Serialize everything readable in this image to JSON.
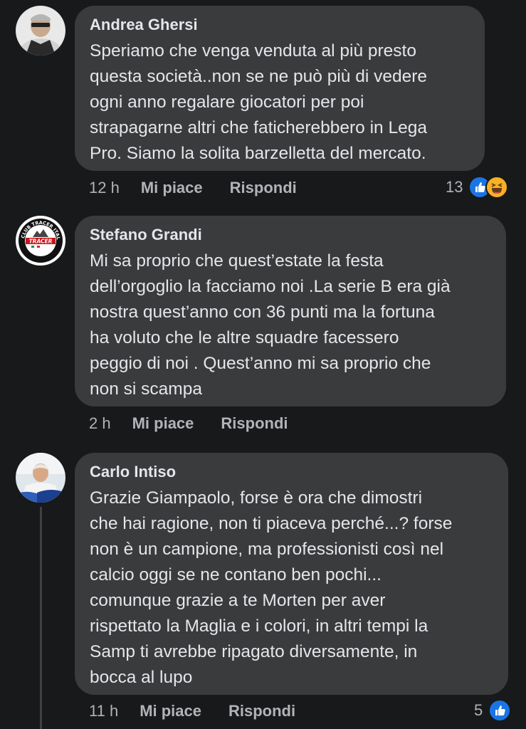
{
  "comments": [
    {
      "author": "Andrea Ghersi",
      "text": "Speriamo che venga venduta al più presto\nquesta società..non se ne può più di vedere\nogni anno regalare giocatori per poi\nstrapagarne altri che faticherebbero in Lega\nPro. Siamo la solita barzelletta del mercato.",
      "time": "12 h",
      "like_label": "Mi piace",
      "reply_label": "Rispondi",
      "reaction_count": "13",
      "reactions": [
        "like-icon",
        "haha-icon"
      ]
    },
    {
      "author": "Stefano Grandi",
      "text": "Mi sa proprio che quest’estate la festa\ndell’orgoglio la facciamo noi .La serie B era già\nnostra quest’anno con 36 punti ma la fortuna\nha voluto che le altre squadre facessero\npeggio di noi . Quest’anno mi sa proprio che\nnon si scampa",
      "time": "2 h",
      "like_label": "Mi piace",
      "reply_label": "Rispondi",
      "avatar_text": "CLUB TRACER ITALIA",
      "avatar_logo": "TRACER"
    },
    {
      "author": "Carlo Intiso",
      "text": "Grazie Giampaolo, forse è ora che dimostri\nche hai ragione, non ti piaceva perché...? forse\nnon è un campione, ma professionisti così nel\ncalcio oggi se ne contano ben pochi...\ncomunque grazie a te Morten per aver\nrispettato la Maglia e i colori, in altri tempi la\nSamp ti avrebbe ripagato diversamente, in\nbocca al lupo",
      "time": "11 h",
      "like_label": "Mi piace",
      "reply_label": "Rispondi",
      "reaction_count": "5",
      "reactions": [
        "like-icon"
      ]
    }
  ],
  "colors": {
    "background": "#18191a",
    "bubble": "#3a3b3c",
    "text": "#e4e6eb",
    "secondary": "#b0b3b8",
    "like_blue": "#1b74e4",
    "haha_yellow": "#f7b125"
  }
}
